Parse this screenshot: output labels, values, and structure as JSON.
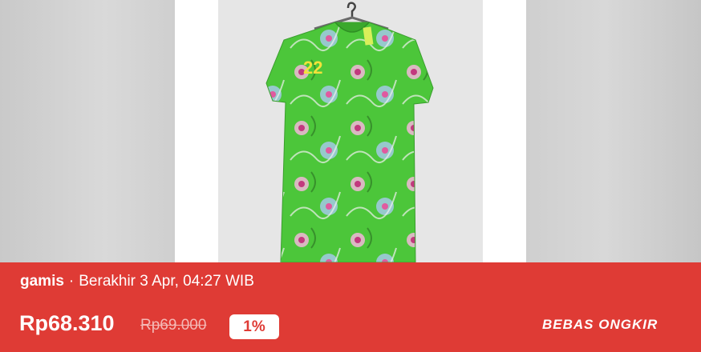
{
  "product": {
    "name": "gamis",
    "separator": "·",
    "end_time": "Berakhir 3 Apr, 04:27 WIB",
    "price": "Rp68.310",
    "original_price": "Rp69.000",
    "discount": "1%",
    "shipping_label": "BEBAS ONGKIR",
    "tag_number": "22"
  },
  "colors": {
    "banner": "#df3b35",
    "dress": "#4cc63a",
    "discount_text": "#df3b35"
  },
  "icons": [
    "hanger-icon"
  ]
}
